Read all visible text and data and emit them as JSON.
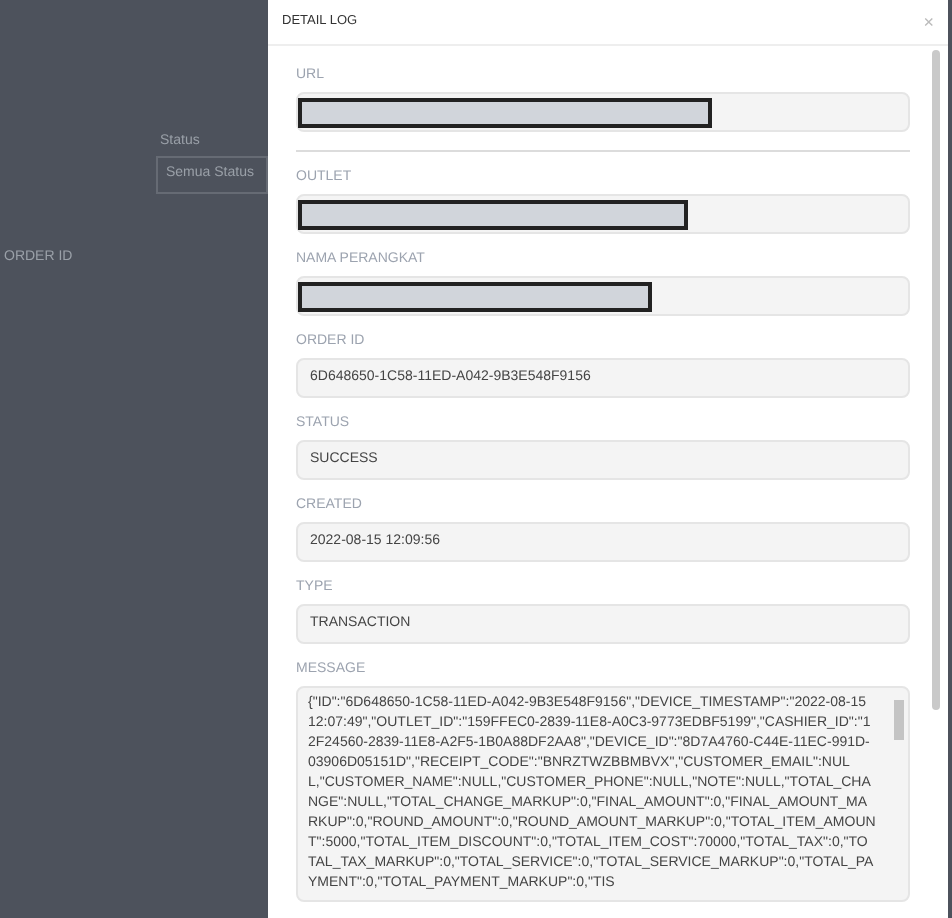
{
  "background": {
    "filter_label": "Status",
    "filter_value": "Semua Status",
    "column_header": "ORDER ID"
  },
  "modal": {
    "title": "DETAIL LOG",
    "close": "×",
    "fields": [
      {
        "kind": "redacted",
        "label": "URL"
      },
      {
        "kind": "redacted",
        "label": "OUTLET"
      },
      {
        "kind": "redacted",
        "label": "NAMA PERANGKAT"
      },
      {
        "kind": "text",
        "label": "ORDER ID",
        "value": "6D648650-1C58-11ED-A042-9B3E548F9156"
      },
      {
        "kind": "text",
        "label": "STATUS",
        "value": "SUCCESS"
      },
      {
        "kind": "text",
        "label": "CREATED",
        "value": "2022-08-15 12:09:56"
      },
      {
        "kind": "text",
        "label": "TYPE",
        "value": "TRANSACTION"
      },
      {
        "kind": "textarea",
        "label": "MESSAGE",
        "value": "{\"ID\":\"6D648650-1C58-11ED-A042-9B3E548F9156\",\"DEVICE_TIMESTAMP\":\"2022-08-15 12:07:49\",\"OUTLET_ID\":\"159FFEC0-2839-11E8-A0C3-9773EDBF5199\",\"CASHIER_ID\":\"12F24560-2839-11E8-A2F5-1B0A88DF2AA8\",\"DEVICE_ID\":\"8D7A4760-C44E-11EC-991D-03906D05151D\",\"RECEIPT_CODE\":\"BNRZTWZBBMBVX\",\"CUSTOMER_EMAIL\":NULL,\"CUSTOMER_NAME\":NULL,\"CUSTOMER_PHONE\":NULL,\"NOTE\":NULL,\"TOTAL_CHANGE\":NULL,\"TOTAL_CHANGE_MARKUP\":0,\"FINAL_AMOUNT\":0,\"FINAL_AMOUNT_MARKUP\":0,\"ROUND_AMOUNT\":0,\"ROUND_AMOUNT_MARKUP\":0,\"TOTAL_ITEM_AMOUNT\":5000,\"TOTAL_ITEM_DISCOUNT\":0,\"TOTAL_ITEM_COST\":70000,\"TOTAL_TAX\":0,\"TOTAL_TAX_MARKUP\":0,\"TOTAL_SERVICE\":0,\"TOTAL_SERVICE_MARKUP\":0,\"TOTAL_PAYMENT\":0,\"TOTAL_PAYMENT_MARKUP\":0,\"TIS"
      }
    ]
  }
}
